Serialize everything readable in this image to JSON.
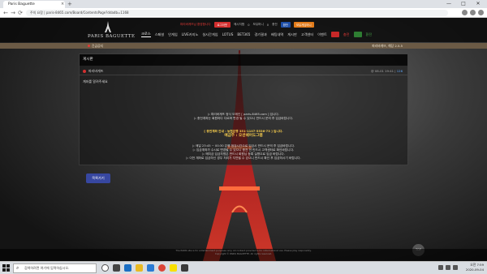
{
  "browser": {
    "tab_title": "Paris Baguette",
    "tab_close": "×",
    "new_tab": "+",
    "url": "주의 요함 | paris-8465.com/Board/ContentsPage?ddadb=1168",
    "window_buttons": [
      "—",
      "□",
      "✕"
    ],
    "nav": {
      "back": "←",
      "forward": "→",
      "reload": "⟳"
    }
  },
  "site": {
    "logo_text": "PARIS BAGUETTE",
    "top_strip": {
      "red_notice": "파리바게뜨님 환영합니다",
      "logout": "로그아웃",
      "messages": "메시지함",
      "message_count": "0",
      "points_label": "보유머니",
      "points_value": "0",
      "charge": "충전",
      "exchange": "환전",
      "deposit": "보유게임머니"
    },
    "nav_items": [
      "크로스",
      "스페셜",
      "인게임",
      "LIVE카지노",
      "실시간게임",
      "LOTUS",
      "BET365",
      "경기결과",
      "배팅내역",
      "게시판",
      "고객센터",
      "이벤트"
    ],
    "nav_red": "충전",
    "nav_green": "환전"
  },
  "notice_bar": {
    "left": "긴급공지",
    "right": "파리바게뜨, 해당 2.5.5"
  },
  "post": {
    "panel_title": "게시판",
    "author": "파리바게뜨",
    "date": "@ 08-01 19:41 |",
    "views": "126",
    "subject": "계좌를 알려주세요",
    "body_lines_1": [
      "▷ 파리바게뜨 정식 도메인 [ paris-8465.com ] 입니다.",
      "▷ 충전계좌는 회원마다 다르며 변경 될 수 있으니 반드시 문의 후 입금바랍니다."
    ],
    "account_line": "[ 충전계좌 안내 : 농협은행 351-1107-5536-73 ] 입니다.",
    "account_holder": "예금주 : 오션쉐어도그램",
    "body_lines_2": [
      "▷ 매일 23:45 ~ 00:30 은행 점검시간으로 입금시 반드시 문의 후 입금바랍니다.",
      "▷ 입금계좌가 수시로 변경될 수 있으니 충전 전 반드시 고객센터로 확인바랍니다.",
      "▷ 예치금 입금자명은 반드시 회원님 등록 실명으로 입금 바랍니다.",
      "▷ 이전 계좌로 입금하신 경우 처리가 지연될 수 있으니 반드시 확인 후 입금하시기 바랍니다."
    ],
    "list_button": "목록가기"
  },
  "footer": {
    "lines": [
      "The PARIS site is for entertainment purposes only. All content provided is for informational use. Please play responsibly.",
      "Copyright © PARIS BAGUETTE. All rights reserved."
    ],
    "top_button": "TOP"
  },
  "taskbar": {
    "search_placeholder": "검색하려면 여기에 입력하십시오.",
    "search_icon": "⌕",
    "time": "오전 7:59",
    "date": "2020-09-04"
  },
  "colors": {
    "accent_gold": "#6b5a45",
    "highlight": "#f2c94c",
    "button": "#3747a0",
    "alert_red": "#d32f2f"
  },
  "icons": {
    "start": "windows-logo-icon",
    "taskbar_apps": [
      "cortana-icon",
      "task-view-icon",
      "edge-icon",
      "explorer-icon",
      "store-icon",
      "chrome-icon",
      "kakaotalk-icon",
      "app-icon"
    ]
  }
}
